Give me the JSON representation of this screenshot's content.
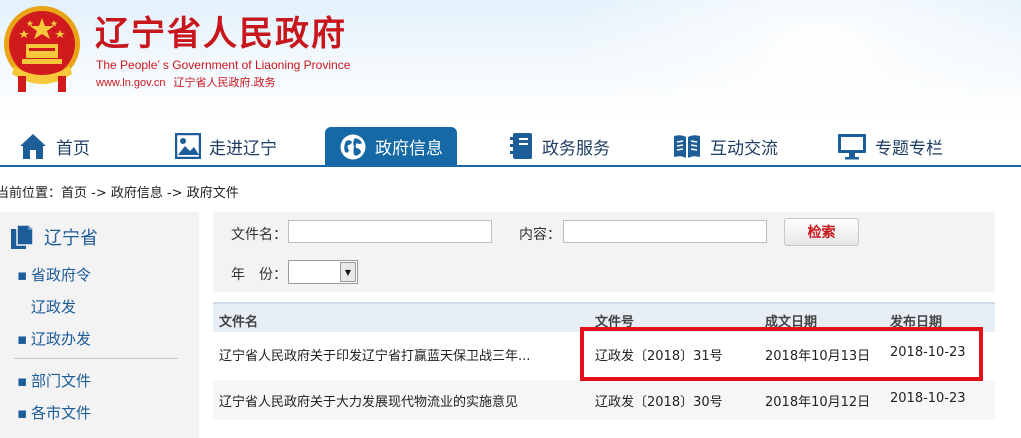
{
  "header": {
    "title": "辽宁省人民政府",
    "subtitle_en": "The People’ s Government of Liaoning Province",
    "url": "www.ln.gov.cn",
    "gov_affairs": "辽宁省人民政府.政务"
  },
  "nav": {
    "items": [
      {
        "label": "首页",
        "icon": "home-icon"
      },
      {
        "label": "走进辽宁",
        "icon": "picture-icon"
      },
      {
        "label": "政府信息",
        "icon": "globe-icon"
      },
      {
        "label": "政务服务",
        "icon": "notebook-icon"
      },
      {
        "label": "互动交流",
        "icon": "book-icon"
      },
      {
        "label": "专题专栏",
        "icon": "monitor-icon"
      }
    ],
    "active": "政府信息"
  },
  "breadcrumb": "当前位置：首页 -> 政府信息 -> 政府文件",
  "sidebar": {
    "heading": "辽宁省",
    "items": [
      {
        "label": "省政府令",
        "bullet": true
      },
      {
        "label": "辽政发",
        "bullet": false
      },
      {
        "label": "辽政办发",
        "bullet": true
      },
      {
        "label": "部门文件",
        "bullet": true
      },
      {
        "label": "各市文件",
        "bullet": true
      }
    ]
  },
  "search": {
    "filename_label": "文件名：",
    "filename_value": "",
    "content_label": "内容：",
    "content_value": "",
    "button_label": "检索",
    "year_label": "年　份：",
    "year_value": ""
  },
  "table": {
    "columns": [
      "文件名",
      "文件号",
      "成文日期",
      "发布日期"
    ],
    "rows": [
      [
        "辽宁省人民政府关于印发辽宁省打赢蓝天保卫战三年...",
        "辽政发〔2018〕31号",
        "2018年10月13日",
        "2018-10-23"
      ],
      [
        "辽宁省人民政府关于大力发展现代物流业的实施意见",
        "辽政发〔2018〕30号",
        "2018年10月12日",
        "2018-10-23"
      ]
    ]
  },
  "colors": {
    "brand_red": "#c8161d",
    "nav_blue": "#1569a6",
    "link_blue": "#1c5c99",
    "highlight_red": "#e5101a"
  }
}
